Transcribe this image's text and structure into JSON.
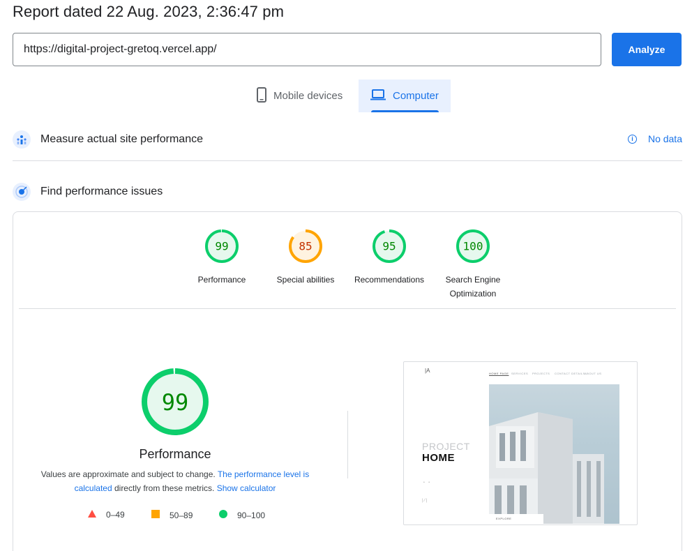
{
  "report": {
    "title": "Report dated 22 Aug. 2023, 2:36:47 pm"
  },
  "search": {
    "value": "https://digital-project-gretoq.vercel.app/",
    "analyze_label": "Analyze"
  },
  "tabs": [
    {
      "label": "Mobile devices",
      "icon": "phone-icon",
      "selected": false
    },
    {
      "label": "Computer",
      "icon": "laptop-icon",
      "selected": true
    }
  ],
  "sections": {
    "field_data": {
      "title": "Measure actual site performance",
      "status": "No data",
      "icon": "chart-people-icon"
    },
    "lab_data": {
      "title": "Find performance issues",
      "icon": "target-icon"
    }
  },
  "scores": [
    {
      "score": "99",
      "value": 99,
      "label": "Performance",
      "color": "#0cce6b",
      "text_color": "#008800",
      "bg": "#e6f8ee"
    },
    {
      "score": "85",
      "value": 85,
      "label": "Special abilities",
      "color": "#ffa400",
      "text_color": "#c33300",
      "bg": "#fff3e0"
    },
    {
      "score": "95",
      "value": 95,
      "label": "Recommendations",
      "color": "#0cce6b",
      "text_color": "#008800",
      "bg": "#e6f8ee"
    },
    {
      "score": "100",
      "value": 100,
      "label_line1": "Search Engine",
      "label_line2": "Optimization",
      "color": "#0cce6b",
      "text_color": "#008800",
      "bg": "#e6f8ee"
    }
  ],
  "performance": {
    "score": "99",
    "value": 99,
    "title": "Performance",
    "note_before": "Values are approximate and subject to change. ",
    "note_link1": "The performance level is calculated",
    "note_middle": " directly from these metrics. ",
    "note_link2": "Show calculator",
    "legend": [
      {
        "range": "0–49",
        "color": "#ff4e42",
        "shape": "triangle"
      },
      {
        "range": "50–89",
        "color": "#ffa400",
        "shape": "square"
      },
      {
        "range": "90–100",
        "color": "#0cce6b",
        "shape": "circle"
      }
    ]
  },
  "screenshot": {
    "nav_items": [
      "HOME PAGE",
      "SERVICES",
      "PROJECTS",
      "CONTACT DETAILS",
      "ABOUT US"
    ],
    "heading_line1": "PROJECT",
    "heading_line2": "HOME",
    "button": "EXPLORE"
  }
}
